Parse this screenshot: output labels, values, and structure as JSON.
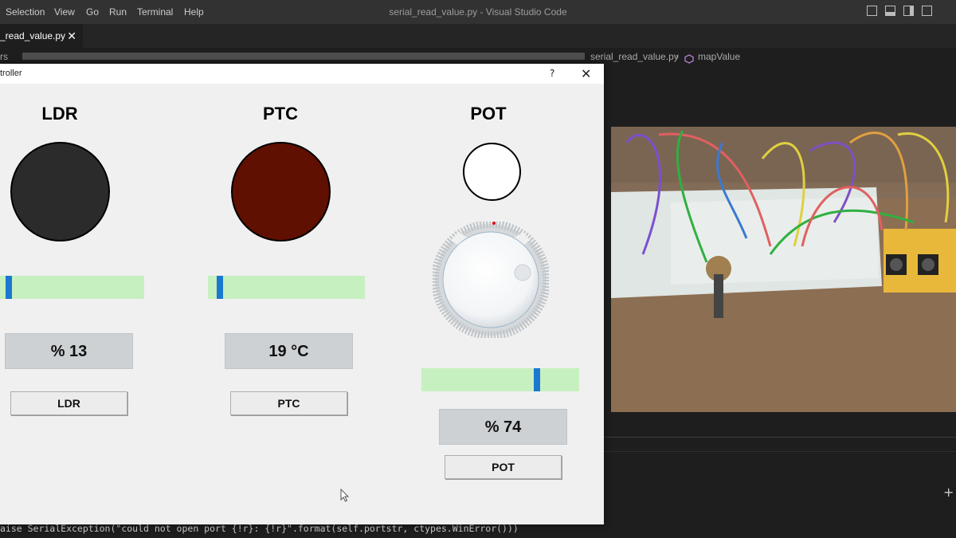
{
  "vscode": {
    "menu": [
      "Selection",
      "View",
      "Go",
      "Run",
      "Terminal",
      "Help"
    ],
    "window_title": "serial_read_value.py - Visual Studio Code",
    "tab": {
      "label": "_read_value.py",
      "close": "✕"
    },
    "breadcrumb": {
      "prefix": "rs",
      "file": "serial_read_value.py",
      "separator": "›",
      "symbol": "mapValue"
    },
    "terminal": [
      "aise SerialException(\"could not open port {!r}: {!r}\".format(self.portstr, ctypes.WinError()))"
    ],
    "panel_add": "+"
  },
  "app": {
    "title": "troller",
    "help": "?",
    "close": "✕",
    "sensors": [
      {
        "name": "LDR",
        "indicator_color": "#2b2b2b",
        "level": 0.04,
        "value": "% 13",
        "button": "LDR"
      },
      {
        "name": "PTC",
        "indicator_color": "#5f1000",
        "level": 0.06,
        "value": "19 °C",
        "button": "PTC"
      },
      {
        "name": "POT",
        "indicator_color": "#ffffff",
        "level": 0.74,
        "value": "% 74",
        "button": "POT"
      }
    ]
  },
  "colors": {
    "bar_track": "#c7f0c0",
    "bar_handle": "#1a78d0",
    "value_box": "#cdd1d3"
  }
}
